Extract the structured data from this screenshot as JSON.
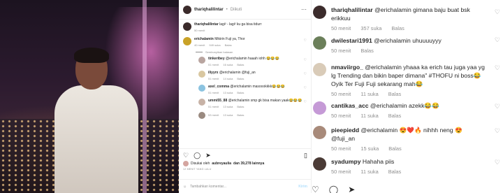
{
  "post": {
    "author": "thariqhalilintar",
    "follow_label": "Diikuti",
    "caption": "lagi² - lagi² ku ga bisa tidurr",
    "caption_age": "50 menit",
    "likes_prefix": "Disukai oleh",
    "likes_user": "aubreyaulia",
    "likes_suffix": "dan 39,278 lainnya",
    "date": "12 MENIT YANG LALU",
    "comment_placeholder": "Tambahkan komentar...",
    "post_label": "Kirim"
  },
  "mid_comments": [
    {
      "user": "erichalamin",
      "text": "Mikirin Fuji ya, Thor",
      "time": "40 menit",
      "likes": "949 suka",
      "reply": "Balas"
    }
  ],
  "hide_replies": "Sembunyikan balasan",
  "mid_replies": [
    {
      "user": "tinkeribey",
      "text": "@erichalamin haaah iohh 😂😂😂",
      "time": "51 menit",
      "likes": "16 suka",
      "reply": "Balas"
    },
    {
      "user": "iliyyrx",
      "text": "@erichalamin @fuji_an",
      "time": "51 menit",
      "likes": "14 suka",
      "reply": "Balas"
    },
    {
      "user": "axel_comma",
      "text": "@erichalamin masoookkkk😂😂😂",
      "time": "51 menit",
      "likes": "13 suka",
      "reply": "Balas"
    },
    {
      "user": "ummi55_88",
      "text": "@erichalamin smp gk bisa makan yaak😂😂😂",
      "time": "51 menit",
      "likes": "13 suka",
      "reply": "Balas"
    },
    {
      "user": "",
      "text": "",
      "time": "53 menit",
      "likes": "13 suka",
      "reply": "Balas"
    }
  ],
  "right_comments": [
    {
      "user": "thariqhalilintar",
      "text": "@erichalamin gimana baju buat bsk erikkuu",
      "time": "50 menit",
      "likes": "357 suka",
      "reply": "Balas"
    },
    {
      "user": "dwilestari1991",
      "text": "@erichalamin uhuuuuyyy",
      "time": "50 menit",
      "likes": "",
      "reply": "Balas"
    },
    {
      "user": "nmaviirgo_",
      "text": "@erichalamin yhaaa ka erich tau juga yaa yg lg Trending dan bikin baper dimana\" #THOFU ni boss😂 Oyik Ter Fuji Fuji sekarang mah😂",
      "time": "50 menit",
      "likes": "11 suka",
      "reply": "Balas"
    },
    {
      "user": "cantikas_acc",
      "text": "@erichalamin azekk😂😂",
      "time": "50 menit",
      "likes": "11 suka",
      "reply": "Balas"
    },
    {
      "user": "pieepiedd",
      "text": "@erichalamin 😍❤️🔥 nihhh neng 😍 @fuji_an",
      "time": "50 menit",
      "likes": "15 suka",
      "reply": "Balas"
    },
    {
      "user": "syadumpy",
      "text": "Hahaha piis",
      "time": "50 menit",
      "likes": "11 suka",
      "reply": "Balas"
    }
  ],
  "colors": {
    "mention": "#00376b",
    "muted": "#8e8e8e",
    "border": "#efefef"
  },
  "icons": [
    "more-icon",
    "heart-icon",
    "comment-icon",
    "share-icon",
    "bookmark-icon",
    "emoji-icon"
  ]
}
